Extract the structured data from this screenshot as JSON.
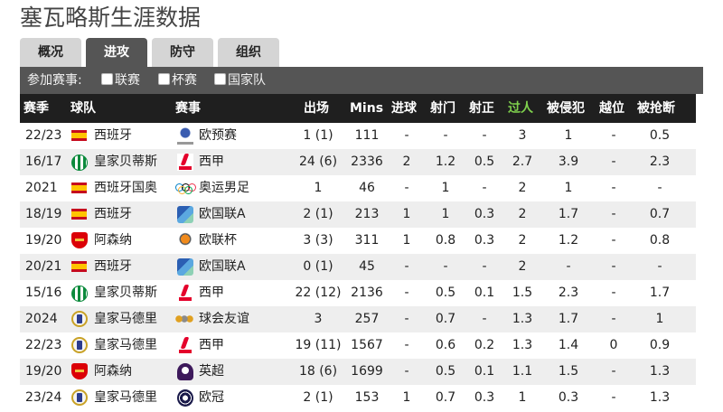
{
  "page": {
    "title": "塞瓦略斯生涯数据"
  },
  "tabs": [
    {
      "label": "概况",
      "active": false
    },
    {
      "label": "进攻",
      "active": true
    },
    {
      "label": "防守",
      "active": false
    },
    {
      "label": "组织",
      "active": false
    }
  ],
  "filters": {
    "label": "参加赛事:",
    "options": [
      {
        "label": "联赛",
        "checked": false
      },
      {
        "label": "杯赛",
        "checked": false
      },
      {
        "label": "国家队",
        "checked": false
      }
    ]
  },
  "table": {
    "columns": [
      "赛季",
      "球队",
      "赛事",
      "出场",
      "Mins",
      "进球",
      "射门",
      "射正",
      "过人",
      "被侵犯",
      "越位",
      "被抢断"
    ],
    "highlight_column": "过人",
    "highlight_color": "#7fd14d",
    "rows": [
      {
        "season": "22/23",
        "team": "西班牙",
        "team_icon": "spain-flag-icon",
        "comp": "欧预赛",
        "comp_icon": "euro-qualifiers-icon",
        "apps": "1 (1)",
        "mins": "111",
        "goals": "-",
        "shots": "-",
        "sot": "-",
        "dribbles": "3",
        "fouled": "1",
        "offsides": "-",
        "dispossessed": "0.5"
      },
      {
        "season": "16/17",
        "team": "皇家贝蒂斯",
        "team_icon": "real-betis-crest-icon",
        "comp": "西甲",
        "comp_icon": "laliga-icon",
        "apps": "24 (6)",
        "mins": "2336",
        "goals": "2",
        "shots": "1.2",
        "sot": "0.5",
        "dribbles": "2.7",
        "fouled": "3.9",
        "offsides": "-",
        "dispossessed": "2.3"
      },
      {
        "season": "2021",
        "team": "西班牙国奥",
        "team_icon": "spain-flag-icon",
        "comp": "奥运男足",
        "comp_icon": "olympic-rings-icon",
        "apps": "1",
        "mins": "46",
        "goals": "-",
        "shots": "1",
        "sot": "-",
        "dribbles": "2",
        "fouled": "1",
        "offsides": "-",
        "dispossessed": "-"
      },
      {
        "season": "18/19",
        "team": "西班牙",
        "team_icon": "spain-flag-icon",
        "comp": "欧国联A",
        "comp_icon": "nations-league-icon",
        "apps": "2 (1)",
        "mins": "213",
        "goals": "1",
        "shots": "1",
        "sot": "0.3",
        "dribbles": "2",
        "fouled": "1.7",
        "offsides": "-",
        "dispossessed": "0.7"
      },
      {
        "season": "19/20",
        "team": "阿森纳",
        "team_icon": "arsenal-crest-icon",
        "comp": "欧联杯",
        "comp_icon": "europa-league-icon",
        "apps": "3 (3)",
        "mins": "311",
        "goals": "1",
        "shots": "0.8",
        "sot": "0.3",
        "dribbles": "2",
        "fouled": "1.2",
        "offsides": "-",
        "dispossessed": "0.8"
      },
      {
        "season": "20/21",
        "team": "西班牙",
        "team_icon": "spain-flag-icon",
        "comp": "欧国联A",
        "comp_icon": "nations-league-icon",
        "apps": "0 (1)",
        "mins": "45",
        "goals": "-",
        "shots": "-",
        "sot": "-",
        "dribbles": "2",
        "fouled": "-",
        "offsides": "-",
        "dispossessed": "-"
      },
      {
        "season": "15/16",
        "team": "皇家贝蒂斯",
        "team_icon": "real-betis-crest-icon",
        "comp": "西甲",
        "comp_icon": "laliga-icon",
        "apps": "22 (12)",
        "mins": "2136",
        "goals": "-",
        "shots": "0.5",
        "sot": "0.1",
        "dribbles": "1.5",
        "fouled": "2.3",
        "offsides": "-",
        "dispossessed": "1.7"
      },
      {
        "season": "2024",
        "team": "皇家马德里",
        "team_icon": "real-madrid-crest-icon",
        "comp": "球会友谊",
        "comp_icon": "club-friendly-icon",
        "apps": "3",
        "mins": "257",
        "goals": "-",
        "shots": "0.7",
        "sot": "-",
        "dribbles": "1.3",
        "fouled": "1.7",
        "offsides": "-",
        "dispossessed": "1"
      },
      {
        "season": "22/23",
        "team": "皇家马德里",
        "team_icon": "real-madrid-crest-icon",
        "comp": "西甲",
        "comp_icon": "laliga-icon",
        "apps": "19 (11)",
        "mins": "1567",
        "goals": "-",
        "shots": "0.6",
        "sot": "0.2",
        "dribbles": "1.3",
        "fouled": "1.4",
        "offsides": "0",
        "dispossessed": "0.9"
      },
      {
        "season": "19/20",
        "team": "阿森纳",
        "team_icon": "arsenal-crest-icon",
        "comp": "英超",
        "comp_icon": "premier-league-icon",
        "apps": "18 (6)",
        "mins": "1699",
        "goals": "-",
        "shots": "0.5",
        "sot": "0.1",
        "dribbles": "1.1",
        "fouled": "1.5",
        "offsides": "-",
        "dispossessed": "1.3"
      },
      {
        "season": "23/24",
        "team": "皇家马德里",
        "team_icon": "real-madrid-crest-icon",
        "comp": "欧冠",
        "comp_icon": "champions-league-icon",
        "apps": "2 (1)",
        "mins": "153",
        "goals": "1",
        "shots": "0.7",
        "sot": "0.3",
        "dribbles": "1",
        "fouled": "0.3",
        "offsides": "-",
        "dispossessed": "1.3"
      }
    ]
  }
}
